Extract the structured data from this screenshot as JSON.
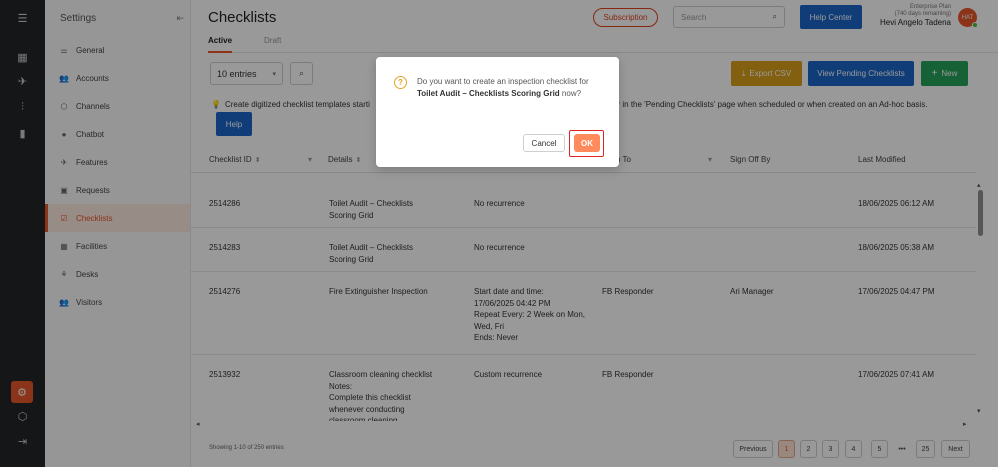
{
  "rail": {
    "items": [
      "menu-icon",
      "dashboard-icon",
      "rocket-icon",
      "analytics-icon",
      "chart-icon",
      "settings-gear-icon",
      "box-icon",
      "logout-icon"
    ]
  },
  "sidebar": {
    "title": "Settings",
    "items": [
      {
        "label": "General",
        "icon": "sliders-icon",
        "glyph": "⚌"
      },
      {
        "label": "Accounts",
        "icon": "accounts-icon",
        "glyph": "👥"
      },
      {
        "label": "Channels",
        "icon": "channels-icon",
        "glyph": "⬡"
      },
      {
        "label": "Chatbot",
        "icon": "chatbot-icon",
        "glyph": "●"
      },
      {
        "label": "Features",
        "icon": "features-icon",
        "glyph": "✈"
      },
      {
        "label": "Requests",
        "icon": "requests-icon",
        "glyph": "▣"
      },
      {
        "label": "Checklists",
        "icon": "checklists-icon",
        "glyph": "☑"
      },
      {
        "label": "Facilities",
        "icon": "facilities-icon",
        "glyph": "▦"
      },
      {
        "label": "Desks",
        "icon": "desks-icon",
        "glyph": "⚘"
      },
      {
        "label": "Visitors",
        "icon": "visitors-icon",
        "glyph": "👥"
      }
    ],
    "active": "Checklists"
  },
  "header": {
    "title": "Checklists",
    "subscription": "Subscription",
    "search_placeholder": "Search",
    "help_center": "Help Center",
    "plan": "Enterprise Plan",
    "days": "(740 days remaining)",
    "user": "Hevi Angelo Tadena",
    "initials": "HAT"
  },
  "tabs": {
    "active": "Active",
    "draft": "Draft"
  },
  "toolbar": {
    "entries": "10 entries",
    "export": "Export CSV",
    "view_pending": "View Pending Checklists",
    "new": "New"
  },
  "info": {
    "text_left": "Create digitized checklist templates starti",
    "text_right": "will appear in the 'Pending Checklists' page when scheduled or when created on an Ad-hoc basis.",
    "help": "Help"
  },
  "table": {
    "columns": [
      "Checklist ID",
      "Details",
      "n To",
      "Sign Off By",
      "Last Modified"
    ],
    "rows": [
      {
        "id": "2514286",
        "details": [
          "Toilet Audit – Checklists",
          "Scoring Grid"
        ],
        "recurrence": [
          "No recurrence"
        ],
        "assigned": "",
        "signoff": "",
        "modified": "18/06/2025 06:12 AM"
      },
      {
        "id": "2514283",
        "details": [
          "Toilet Audit – Checklists",
          "Scoring Grid"
        ],
        "recurrence": [
          "No recurrence"
        ],
        "assigned": "",
        "signoff": "",
        "modified": "18/06/2025 05:38 AM"
      },
      {
        "id": "2514276",
        "details": [
          "Fire Extinguisher Inspection"
        ],
        "recurrence": [
          "Start date and time:",
          "17/06/2025 04:42 PM",
          "Repeat Every: 2 Week on Mon,",
          "Wed, Fri",
          "Ends: Never"
        ],
        "assigned": "FB Responder",
        "signoff": "Ari Manager",
        "modified": "17/06/2025 04:47 PM"
      },
      {
        "id": "2513932",
        "details": [
          "Classroom cleaning checklist",
          "Notes:",
          "Complete this checklist",
          "whenever conducting",
          "classroom cleaning"
        ],
        "recurrence": [
          "Custom recurrence"
        ],
        "assigned": "FB Responder",
        "signoff": "",
        "modified": "17/06/2025 07:41 AM"
      }
    ]
  },
  "footer": {
    "showing": "Showing 1-10 of 250 entries",
    "previous": "Previous",
    "pages": [
      "1",
      "2",
      "3",
      "4",
      "5"
    ],
    "ellipsis": "•••",
    "last": "25",
    "next": "Next"
  },
  "modal": {
    "prefix": "Do you want to create an inspection checklist for",
    "name": "Toilet Audit – Checklists Scoring Grid",
    "suffix": "now?",
    "cancel": "Cancel",
    "ok": "OK"
  },
  "colors": {
    "accent": "#e8572a",
    "primary": "#1b66c9",
    "success": "#27a25a",
    "warning": "#d9a11c"
  }
}
